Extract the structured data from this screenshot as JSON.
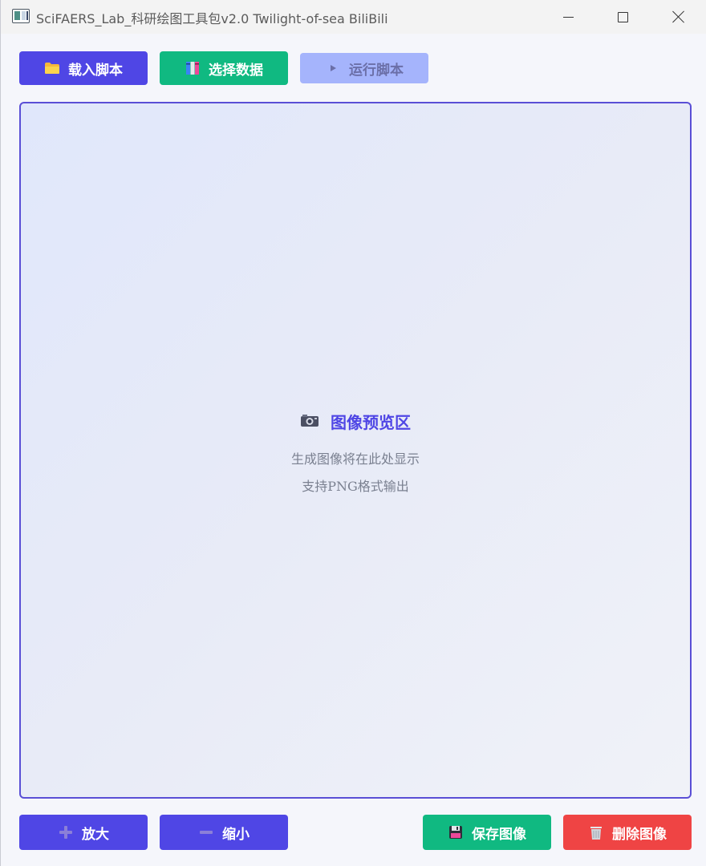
{
  "window": {
    "title": "SciFAERS_Lab_科研绘图工具包v2.0 Twilight-of-sea BiliBili"
  },
  "toolbar": {
    "load_script": "载入脚本",
    "select_data": "选择数据",
    "run_script": "运行脚本"
  },
  "preview": {
    "title": "图像预览区",
    "line1": "生成图像将在此处显示",
    "line2": "支持PNG格式输出"
  },
  "bottom": {
    "zoom_in": "放大",
    "zoom_out": "缩小",
    "save_image": "保存图像",
    "delete_image": "删除图像"
  },
  "icons": {
    "load": "folder-icon",
    "data": "books-icon",
    "run": "play-icon",
    "preview": "camera-icon",
    "zoom_in": "plus-icon",
    "zoom_out": "minus-icon",
    "save": "floppy-disk-icon",
    "delete": "trash-icon"
  },
  "colors": {
    "primary": "#4f46e5",
    "success": "#10b981",
    "danger": "#ef4444",
    "disabled": "#a5b4fc"
  }
}
